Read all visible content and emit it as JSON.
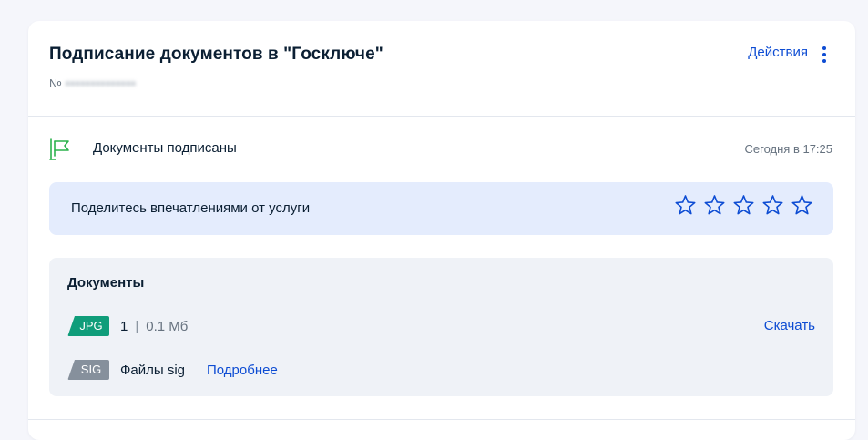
{
  "header": {
    "title": "Подписание документов в \"Госключе\"",
    "order_prefix": "№",
    "order_number": "••••••••••••••",
    "actions_label": "Действия"
  },
  "status": {
    "icon": "flag-icon",
    "text": "Документы подписаны",
    "time": "Сегодня в 17:25"
  },
  "feedback": {
    "text": "Поделитесь впечатлениями от услуги",
    "rating_max": 5,
    "rating_value": 0
  },
  "documents": {
    "title": "Документы",
    "files": [
      {
        "badge": "JPG",
        "count": "1",
        "size": "0.1 Мб",
        "action": "Скачать"
      },
      {
        "badge": "SIG",
        "name": "Файлы sig",
        "link": "Подробнее"
      }
    ]
  },
  "colors": {
    "accent": "#0d4cd3",
    "success": "#2bb24c",
    "jpg_badge": "#0f9d7a",
    "sig_badge": "#86909c",
    "feedback_bg": "#e4ecfd",
    "docs_bg": "#eff2f7"
  }
}
